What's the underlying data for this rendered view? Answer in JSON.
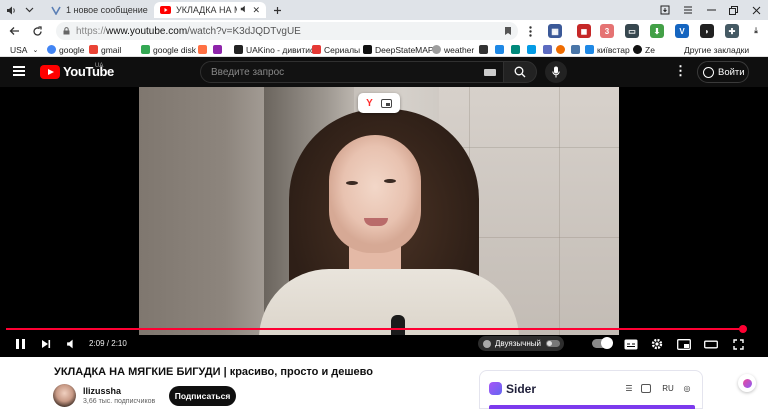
{
  "browser": {
    "tabs": [
      {
        "label": "1 новое сообщение",
        "active": false
      },
      {
        "label": "УКЛАДКА НА МЯГКИЕ",
        "active": true
      }
    ],
    "url_scheme": "https://",
    "url_host": "www.youtube.com",
    "url_path": "/watch?v=K3dJQDTvgUE",
    "bookmarks": [
      {
        "label": "USA",
        "color": "#ffffff"
      },
      {
        "label": "google",
        "color": "#4285f4"
      },
      {
        "label": "gmail",
        "color": "#ea4335"
      },
      {
        "label": "google disk",
        "color": "#34a853"
      },
      {
        "label": "UAKino - дивитис",
        "color": "#222222"
      },
      {
        "label": "Сериалы",
        "color": "#e53935"
      },
      {
        "label": "DeepStateMAP",
        "color": "#111111"
      },
      {
        "label": "weather",
        "color": "#7a7a7a"
      },
      {
        "label": "київстар",
        "color": "#1e88e5"
      },
      {
        "label": "Ze",
        "color": "#111111"
      }
    ],
    "other_bookmarks": "Другие закладки"
  },
  "youtube": {
    "logo_text": "YouTube",
    "region": "UA",
    "search_placeholder": "Введите запрос",
    "sign_in": "Войти"
  },
  "player": {
    "time": "2:09 / 2:10",
    "progress": 0.99,
    "ai_dub_label": "Двуязычный",
    "accent": "#ff0033"
  },
  "video": {
    "title": "УКЛАДКА НА МЯГКИЕ БИГУДИ | красиво, просто и дешево",
    "channel": "llizussha",
    "subscribers": "3,66 тыс. подписчиков",
    "subscribe": "Подписаться"
  },
  "sider": {
    "name": "Sider",
    "lang": "RU"
  }
}
